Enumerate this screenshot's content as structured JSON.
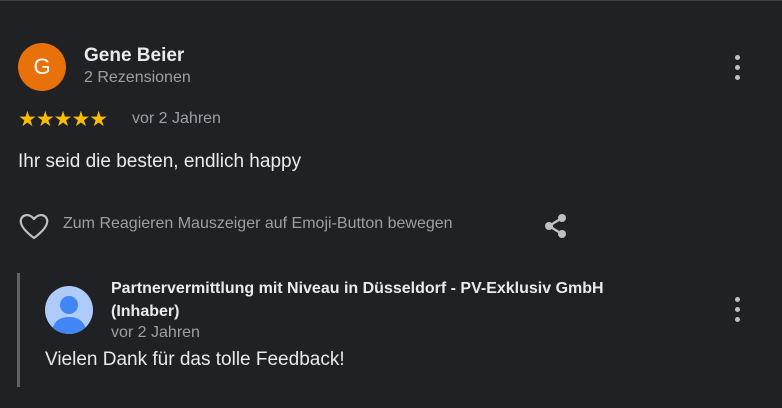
{
  "review": {
    "avatar_letter": "G",
    "reviewer_name": "Gene Beier",
    "reviewer_meta": "2 Rezensionen",
    "rating": 5,
    "stars": "★★★★★",
    "date": "vor 2 Jahren",
    "text": "Ihr seid die besten, endlich happy",
    "react_hint": "Zum Reagieren Mauszeiger auf Emoji-Button bewegen",
    "avatar_color": "#e8710a",
    "star_color": "#fbbc04"
  },
  "owner_response": {
    "owner_name": "Partnervermittlung mit Niveau in Düsseldorf - PV-Exklusiv GmbH",
    "owner_role": "(Inhaber)",
    "date": "vor 2 Jahren",
    "text": "Vielen Dank für das tolle Feedback!",
    "avatar_color": "#aecbfa"
  },
  "icons": {
    "more_options": "more-vert-icon",
    "like": "heart-icon",
    "share": "share-icon",
    "owner_avatar": "person-icon"
  },
  "theme": {
    "background": "#202124",
    "text_primary": "#e8eaed",
    "text_secondary": "#9aa0a6"
  }
}
